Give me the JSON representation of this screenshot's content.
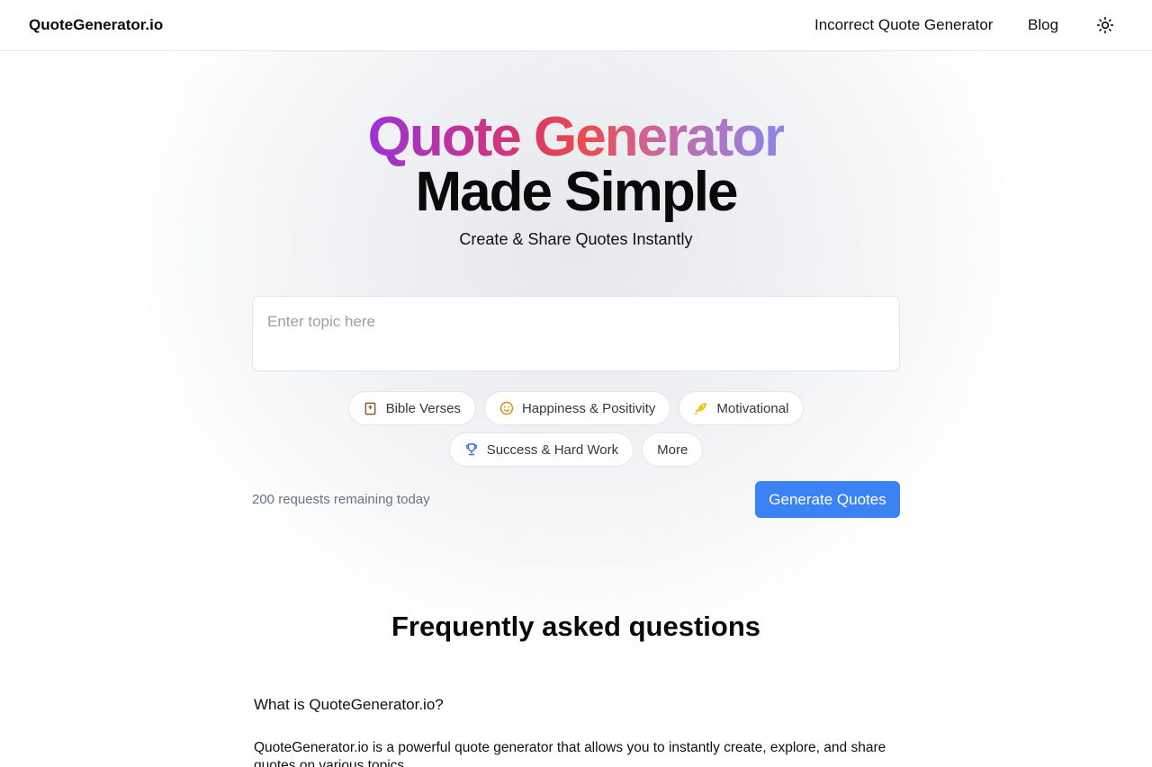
{
  "header": {
    "logo": "QuoteGenerator.io",
    "nav": [
      "Incorrect Quote Generator",
      "Blog"
    ],
    "theme_icon": "sun-icon"
  },
  "hero": {
    "title_gradient": "Quote Generator",
    "title_plain": "Made Simple",
    "subtitle": "Create & Share Quotes Instantly"
  },
  "topic_input": {
    "placeholder": "Enter topic here",
    "value": ""
  },
  "chips": [
    {
      "label": "Bible Verses",
      "icon": "book-icon",
      "color": "#8b5a2b"
    },
    {
      "label": "Happiness & Positivity",
      "icon": "smile-icon",
      "color": "#e08a1e"
    },
    {
      "label": "Motivational",
      "icon": "rocket-icon",
      "color": "#e5b800"
    },
    {
      "label": "Success & Hard Work",
      "icon": "trophy-icon",
      "color": "#3b6fd6"
    },
    {
      "label": "More",
      "icon": "",
      "color": ""
    }
  ],
  "remaining_text": "200 requests remaining today",
  "generate_button": "Generate Quotes",
  "faq": {
    "title": "Frequently asked questions",
    "items": [
      {
        "question": "What is QuoteGenerator.io?",
        "answer": "QuoteGenerator.io is a powerful quote generator that allows you to instantly create, explore, and share quotes on various topics."
      }
    ]
  },
  "colors": {
    "accent": "#3b82f6",
    "gradient": [
      "#9b34d6",
      "#ea4c4c",
      "#8b86e8"
    ]
  }
}
